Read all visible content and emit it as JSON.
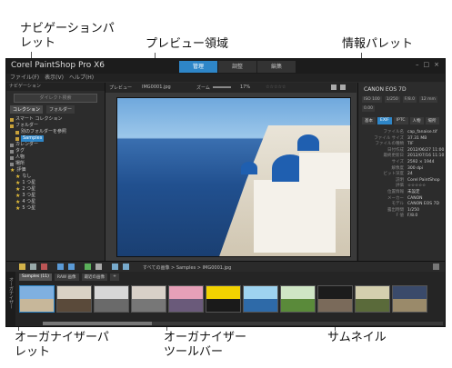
{
  "callouts": {
    "navigation_palette": "ナビゲーションパ\nレット",
    "preview_area": "プレビュー領域",
    "info_palette": "情報パレット",
    "organizer_palette": "オーガナイザーパ\nレット",
    "organizer_toolbar": "オーガナイザー\nツールバー",
    "thumbnail": "サムネイル"
  },
  "app": {
    "title": "Corel PaintShop Pro X6",
    "tabs": [
      {
        "label": "管理",
        "active": true
      },
      {
        "label": "調整",
        "active": false
      },
      {
        "label": "編集",
        "active": false
      }
    ],
    "menu": [
      "ファイル(F)",
      "表示(V)",
      "ヘルプ(H)"
    ]
  },
  "nav": {
    "header": "ナビゲーション",
    "search_placeholder": "ダイレクト検索",
    "tabs": [
      {
        "label": "コレクション",
        "active": true
      },
      {
        "label": "フォルダー",
        "active": false
      }
    ],
    "tree": [
      {
        "label": "スマート コレクション",
        "kind": "folder"
      },
      {
        "label": "フォルダー",
        "kind": "folder"
      },
      {
        "label": "別のフォルダーを参照",
        "kind": "folder"
      },
      {
        "label": "Samples",
        "kind": "folder",
        "selected": true
      },
      {
        "label": "カレンダー",
        "kind": "folder"
      },
      {
        "label": "タグ",
        "kind": "folder"
      },
      {
        "label": "人物",
        "kind": "folder"
      },
      {
        "label": "場所",
        "kind": "folder"
      },
      {
        "label": "評価",
        "kind": "folder"
      },
      {
        "label": "なし",
        "kind": "rating"
      },
      {
        "label": "1 つ星",
        "kind": "rating"
      },
      {
        "label": "2 つ星",
        "kind": "rating"
      },
      {
        "label": "3 つ星",
        "kind": "rating"
      },
      {
        "label": "4 つ星",
        "kind": "rating"
      },
      {
        "label": "5 つ星",
        "kind": "rating"
      }
    ]
  },
  "preview": {
    "label": "プレビュー",
    "filename": "IMG0001.jpg",
    "zoom_label": "ズーム",
    "zoom_value": "17%",
    "rating": "☆☆☆☆☆"
  },
  "info": {
    "camera": "CANON EOS 7D",
    "exif": [
      "ISO 100",
      "1/250",
      "F/8.0",
      "12 mm",
      "0.00"
    ],
    "tabs": [
      {
        "label": "基本",
        "active": false
      },
      {
        "label": "EXIF",
        "active": true
      },
      {
        "label": "IPTC",
        "active": false
      },
      {
        "label": "人物",
        "active": false
      },
      {
        "label": "場所",
        "active": false
      }
    ],
    "properties": [
      {
        "key": "ファイル名",
        "value": "cap_fanaise.tif"
      },
      {
        "key": "ファイル サイズ",
        "value": "37.31 MB"
      },
      {
        "key": "ファイルの種類",
        "value": "TIF"
      },
      {
        "key": "日付作成",
        "value": "2012/06/27 11:00"
      },
      {
        "key": "最終更新日",
        "value": "2012/07/16 11:10"
      },
      {
        "key": "サイズ",
        "value": "2592 × 1944"
      },
      {
        "key": "解像度",
        "value": "300 dpi"
      },
      {
        "key": "ビット深度",
        "value": "24"
      },
      {
        "key": "説明",
        "value": "Corel PaintShop"
      },
      {
        "key": "評価",
        "value": "☆☆☆☆☆"
      },
      {
        "key": "位置情報",
        "value": "未設定"
      },
      {
        "key": "メーカー",
        "value": "CANON"
      },
      {
        "key": "モデル",
        "value": "CANON EOS 7D"
      },
      {
        "key": "露出時間",
        "value": "1/250"
      },
      {
        "key": "F 値",
        "value": "F/8.0"
      }
    ]
  },
  "organizer": {
    "path": "すべての画像 > Samples > IMG0001.jpg",
    "tabs": [
      {
        "label": "Samples (11)",
        "active": true
      },
      {
        "label": "RAW 画像",
        "active": false
      },
      {
        "label": "最近の画像",
        "active": false
      }
    ],
    "side_label": "オーガナイザー",
    "thumbnails": [
      {
        "sky": "#7fb0e0",
        "ground": "#c7b79a",
        "selected": true
      },
      {
        "sky": "#d9d2c5",
        "ground": "#5a4a3a",
        "selected": false
      },
      {
        "sky": "#d7d7d7",
        "ground": "#6a6a6a",
        "selected": false
      },
      {
        "sky": "#d8d0c8",
        "ground": "#777777",
        "selected": false
      },
      {
        "sky": "#e6a0b8",
        "ground": "#6a5a7a",
        "selected": false
      },
      {
        "sky": "#f2d200",
        "ground": "#1a1a1a",
        "selected": false
      },
      {
        "sky": "#9ed3f0",
        "ground": "#2e6aa8",
        "selected": false
      },
      {
        "sky": "#cfe6c5",
        "ground": "#5a8a3a",
        "selected": false
      },
      {
        "sky": "#1c1c1c",
        "ground": "#7a6a5a",
        "selected": false
      },
      {
        "sky": "#d4cfae",
        "ground": "#5a6a3a",
        "selected": false
      },
      {
        "sky": "#3a4a6a",
        "ground": "#9a8a6a",
        "selected": false
      }
    ]
  }
}
